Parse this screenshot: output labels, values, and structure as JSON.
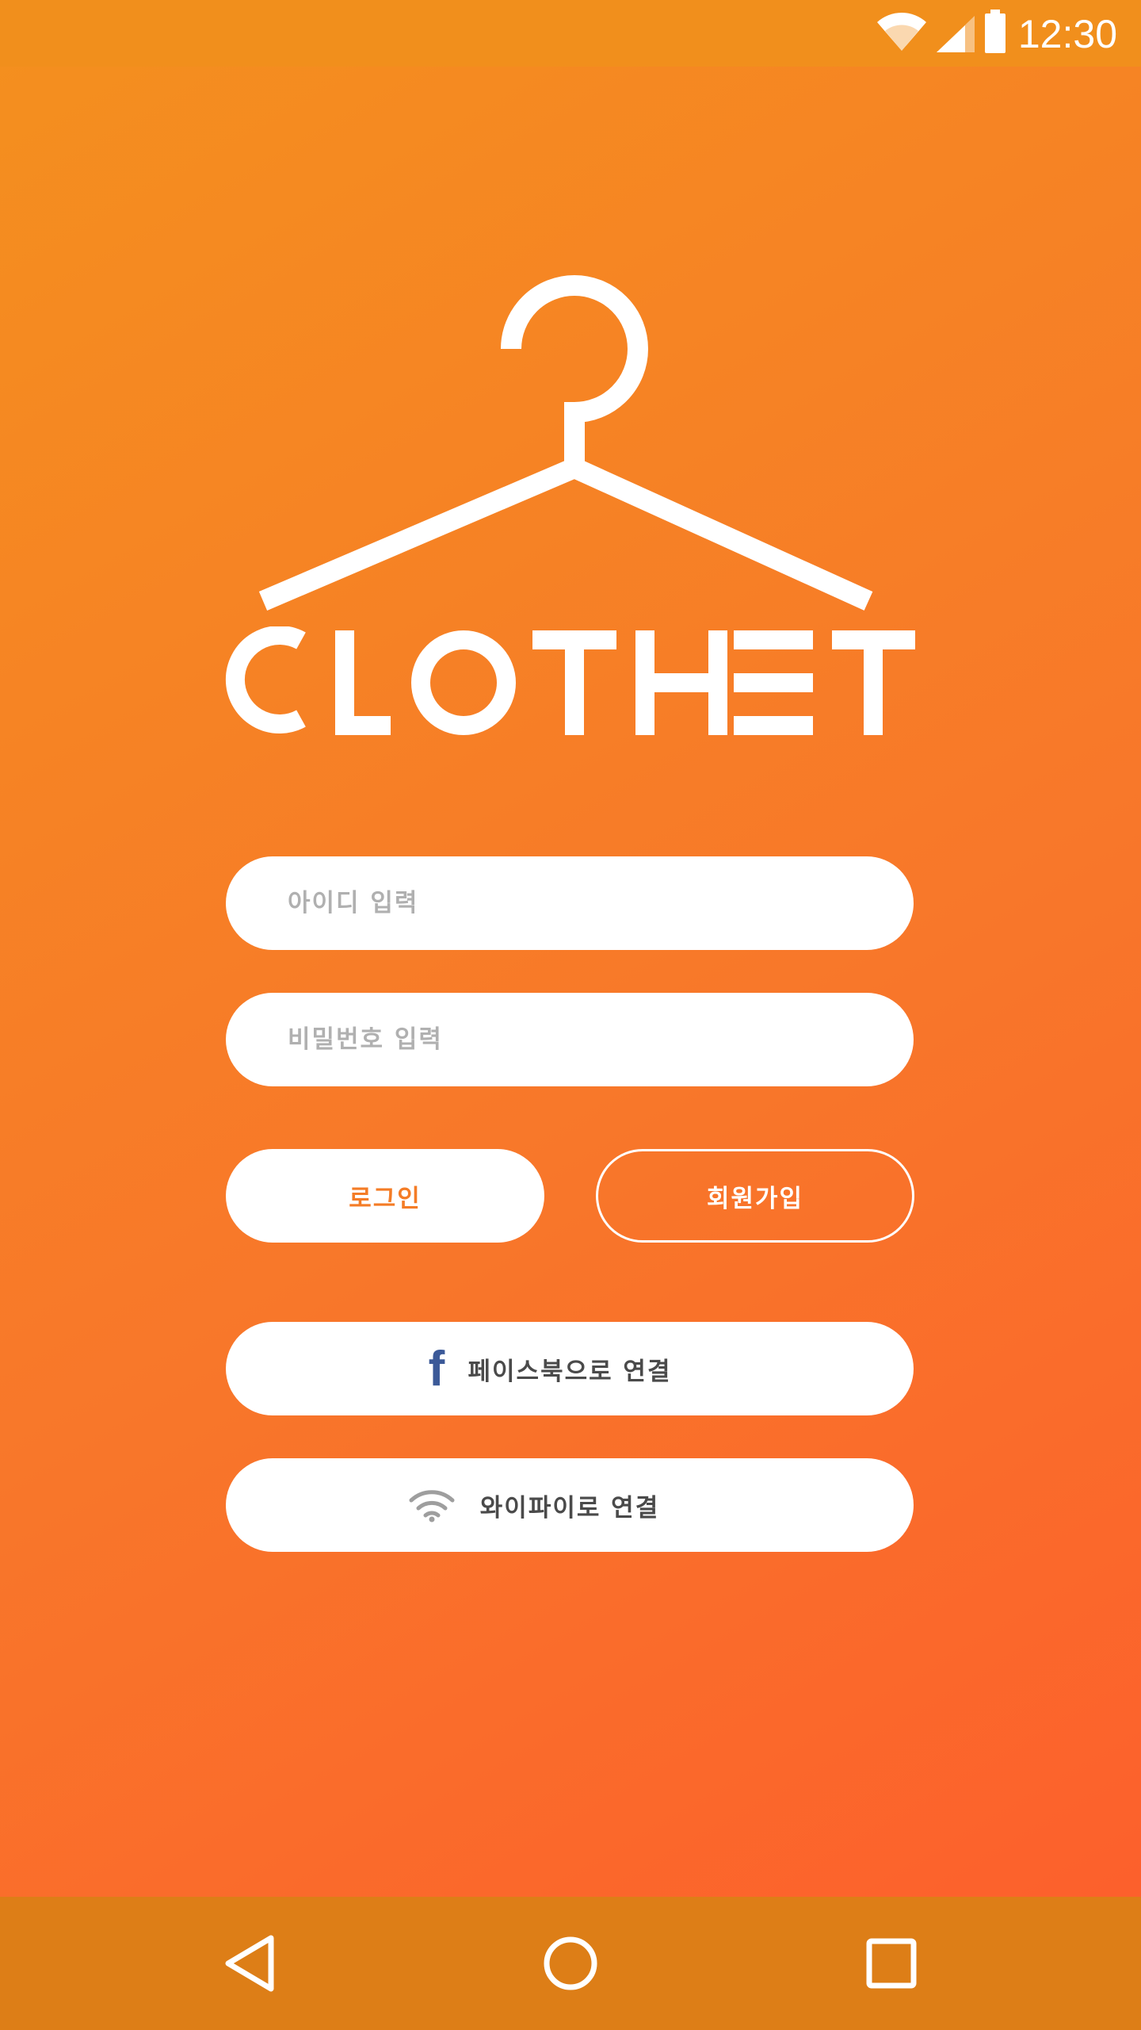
{
  "status_bar": {
    "time": "12:30",
    "icons": [
      "wifi-icon",
      "signal-icon",
      "battery-icon"
    ]
  },
  "logo": {
    "text": "CLOTHET",
    "icon": "hanger-icon"
  },
  "login_form": {
    "id_placeholder": "아이디 입력",
    "id_value": "",
    "password_placeholder": "비밀번호 입력",
    "password_value": ""
  },
  "buttons": {
    "login_label": "로그인",
    "signup_label": "회원가입",
    "facebook_icon": "f",
    "facebook_label": "페이스북으로 연결",
    "wifi_label": "와이파이로 연결"
  },
  "nav_bar": {
    "icons": [
      "back-icon",
      "home-icon",
      "recents-icon"
    ]
  },
  "colors": {
    "gradient_start": "#f4901e",
    "gradient_end": "#fd5d2c",
    "status_bar": "#f18f1c",
    "nav_bar": "#dd7e17",
    "accent_text": "#f47c26",
    "facebook_blue": "#3b5998",
    "white": "#ffffff"
  }
}
